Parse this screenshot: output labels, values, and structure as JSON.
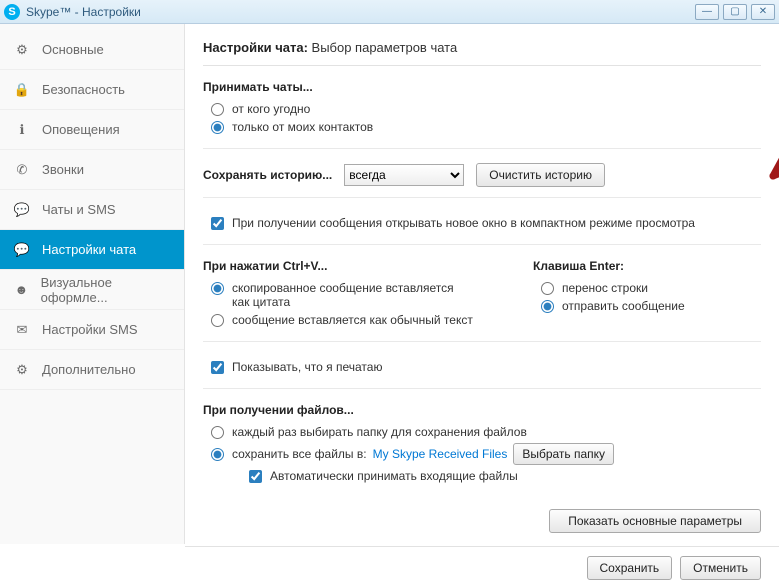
{
  "window": {
    "title": "Skype™ - Настройки"
  },
  "sidebar": {
    "items": [
      {
        "label": "Основные"
      },
      {
        "label": "Безопасность"
      },
      {
        "label": "Оповещения"
      },
      {
        "label": "Звонки"
      },
      {
        "label": "Чаты и SMS"
      },
      {
        "label": "Настройки чата"
      },
      {
        "label": "Визуальное оформле..."
      },
      {
        "label": "Настройки SMS"
      },
      {
        "label": "Дополнительно"
      }
    ]
  },
  "header": {
    "bold": "Настройки чата:",
    "rest": " Выбор параметров чата"
  },
  "accept": {
    "title": "Принимать чаты...",
    "opt_anyone": "от кого угодно",
    "opt_contacts": "только от моих контактов"
  },
  "history": {
    "label": "Сохранять историю...",
    "value": "всегда",
    "clear_btn": "Очистить историю"
  },
  "compact_checkbox": "При получении сообщения открывать новое окно в компактном режиме просмотра",
  "paste": {
    "title": "При нажатии Ctrl+V...",
    "opt_quote": "скопированное сообщение вставляется как цитата",
    "opt_plain": "сообщение вставляется как обычный текст"
  },
  "enter": {
    "title": "Клавиша Enter:",
    "opt_newline": "перенос строки",
    "opt_send": "отправить сообщение"
  },
  "typing_checkbox": "Показывать, что я печатаю",
  "files": {
    "title": "При получении файлов...",
    "opt_ask": "каждый раз выбирать папку для сохранения файлов",
    "opt_saveto": "сохранить все файлы в:",
    "folder_link": "My Skype Received Files",
    "choose_btn": "Выбрать папку",
    "auto_accept": "Автоматически принимать входящие файлы"
  },
  "show_basic_btn": "Показать основные параметры",
  "footer": {
    "save": "Сохранить",
    "cancel": "Отменить"
  }
}
